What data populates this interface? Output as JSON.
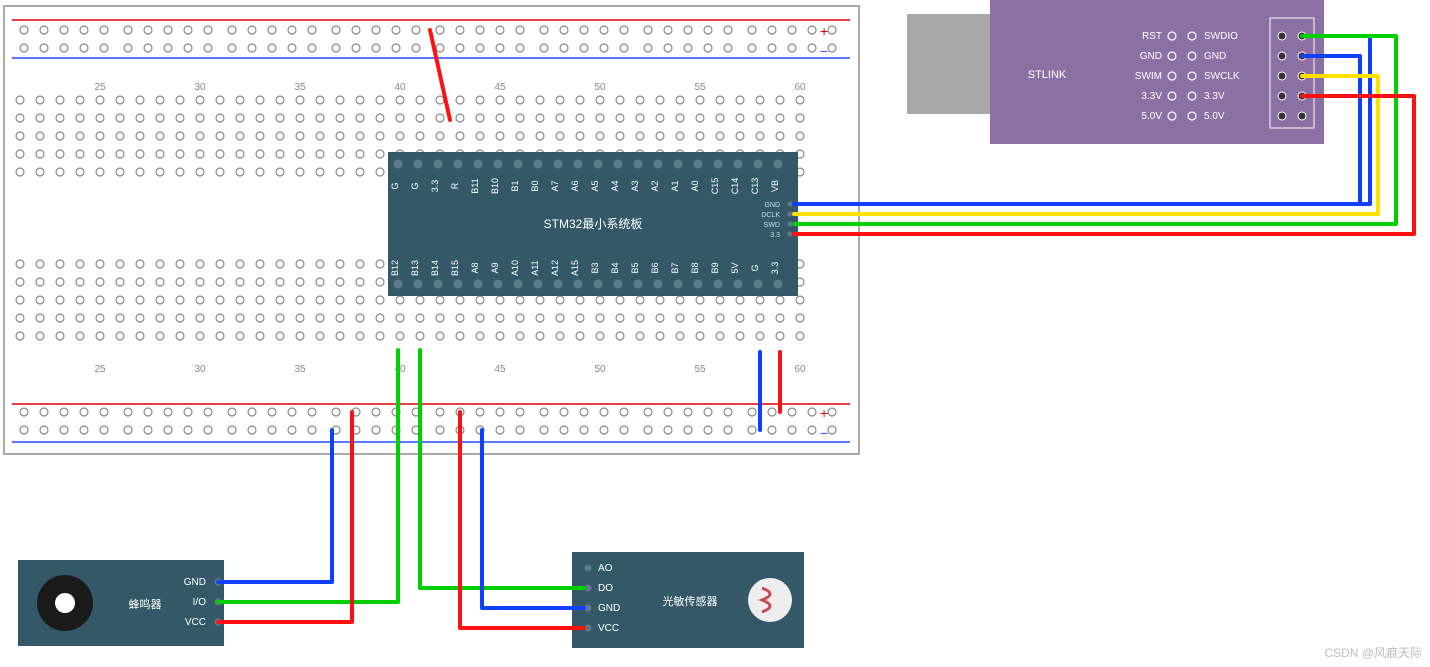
{
  "breadboard": {
    "col_numbers": [
      "25",
      "30",
      "35",
      "40",
      "45",
      "50",
      "55",
      "60"
    ],
    "rail_plus": "+",
    "rail_minus": "−"
  },
  "stm32": {
    "label": "STM32最小系统板",
    "top_pins": [
      "G",
      "G",
      "3.3",
      "R",
      "B11",
      "B10",
      "B1",
      "B0",
      "A7",
      "A6",
      "A5",
      "A4",
      "A3",
      "A2",
      "A1",
      "A0",
      "C15",
      "C14",
      "C13",
      "VB"
    ],
    "bottom_pins": [
      "B12",
      "B13",
      "B14",
      "B15",
      "A8",
      "A9",
      "A10",
      "A11",
      "A12",
      "A15",
      "B3",
      "B4",
      "B5",
      "B6",
      "B7",
      "B8",
      "B9",
      "5V",
      "G",
      "3.3"
    ],
    "side_pins": [
      "GND",
      "DCLK",
      "SWD",
      "3.3"
    ]
  },
  "stlink": {
    "label": "STLINK",
    "left_pins": [
      "RST",
      "GND",
      "SWIM",
      "3.3V",
      "5.0V"
    ],
    "right_pins": [
      "SWDIO",
      "GND",
      "SWCLK",
      "3.3V",
      "5.0V"
    ]
  },
  "buzzer": {
    "title": "蜂鸣器",
    "pins": [
      "GND",
      "I/O",
      "VCC"
    ]
  },
  "sensor": {
    "title": "光敏传感器",
    "pins": [
      "AO",
      "DO",
      "GND",
      "VCC"
    ]
  },
  "wire_colors": {
    "gnd": "#1040ff",
    "vcc": "#ff1010",
    "sig1": "#00d000",
    "sig2": "#ffe000"
  },
  "watermark": "CSDN @风痕天际"
}
